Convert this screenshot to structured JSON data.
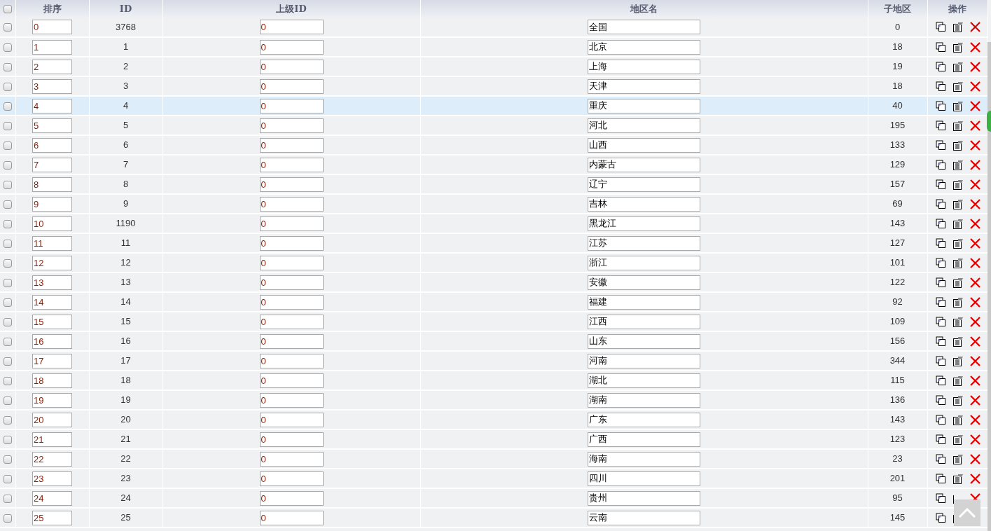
{
  "table": {
    "select_all": {
      "checked": false
    },
    "columns": [
      "排序",
      "ID",
      "上级ID",
      "地区名",
      "子地区",
      "操作"
    ],
    "rows": [
      {
        "checked": false,
        "highlighted": false,
        "sort": "0",
        "id": "3768",
        "parent_id": "0",
        "name": "全国",
        "children_count": "0"
      },
      {
        "checked": false,
        "highlighted": false,
        "sort": "1",
        "id": "1",
        "parent_id": "0",
        "name": "北京",
        "children_count": "18"
      },
      {
        "checked": false,
        "highlighted": false,
        "sort": "2",
        "id": "2",
        "parent_id": "0",
        "name": "上海",
        "children_count": "19"
      },
      {
        "checked": false,
        "highlighted": false,
        "sort": "3",
        "id": "3",
        "parent_id": "0",
        "name": "天津",
        "children_count": "18"
      },
      {
        "checked": false,
        "highlighted": true,
        "sort": "4",
        "id": "4",
        "parent_id": "0",
        "name": "重庆",
        "children_count": "40"
      },
      {
        "checked": false,
        "highlighted": false,
        "sort": "5",
        "id": "5",
        "parent_id": "0",
        "name": "河北",
        "children_count": "195"
      },
      {
        "checked": false,
        "highlighted": false,
        "sort": "6",
        "id": "6",
        "parent_id": "0",
        "name": "山西",
        "children_count": "133"
      },
      {
        "checked": false,
        "highlighted": false,
        "sort": "7",
        "id": "7",
        "parent_id": "0",
        "name": "内蒙古",
        "children_count": "129"
      },
      {
        "checked": false,
        "highlighted": false,
        "sort": "8",
        "id": "8",
        "parent_id": "0",
        "name": "辽宁",
        "children_count": "157"
      },
      {
        "checked": false,
        "highlighted": false,
        "sort": "9",
        "id": "9",
        "parent_id": "0",
        "name": "吉林",
        "children_count": "69"
      },
      {
        "checked": false,
        "highlighted": false,
        "sort": "10",
        "id": "1190",
        "parent_id": "0",
        "name": "黑龙江",
        "children_count": "143"
      },
      {
        "checked": false,
        "highlighted": false,
        "sort": "11",
        "id": "11",
        "parent_id": "0",
        "name": "江苏",
        "children_count": "127"
      },
      {
        "checked": false,
        "highlighted": false,
        "sort": "12",
        "id": "12",
        "parent_id": "0",
        "name": "浙江",
        "children_count": "101"
      },
      {
        "checked": false,
        "highlighted": false,
        "sort": "13",
        "id": "13",
        "parent_id": "0",
        "name": "安徽",
        "children_count": "122"
      },
      {
        "checked": false,
        "highlighted": false,
        "sort": "14",
        "id": "14",
        "parent_id": "0",
        "name": "福建",
        "children_count": "92"
      },
      {
        "checked": false,
        "highlighted": false,
        "sort": "15",
        "id": "15",
        "parent_id": "0",
        "name": "江西",
        "children_count": "109"
      },
      {
        "checked": false,
        "highlighted": false,
        "sort": "16",
        "id": "16",
        "parent_id": "0",
        "name": "山东",
        "children_count": "156"
      },
      {
        "checked": false,
        "highlighted": false,
        "sort": "17",
        "id": "17",
        "parent_id": "0",
        "name": "河南",
        "children_count": "344"
      },
      {
        "checked": false,
        "highlighted": false,
        "sort": "18",
        "id": "18",
        "parent_id": "0",
        "name": "湖北",
        "children_count": "115"
      },
      {
        "checked": false,
        "highlighted": false,
        "sort": "19",
        "id": "19",
        "parent_id": "0",
        "name": "湖南",
        "children_count": "136"
      },
      {
        "checked": false,
        "highlighted": false,
        "sort": "20",
        "id": "20",
        "parent_id": "0",
        "name": "广东",
        "children_count": "143"
      },
      {
        "checked": false,
        "highlighted": false,
        "sort": "21",
        "id": "21",
        "parent_id": "0",
        "name": "广西",
        "children_count": "123"
      },
      {
        "checked": false,
        "highlighted": false,
        "sort": "22",
        "id": "22",
        "parent_id": "0",
        "name": "海南",
        "children_count": "23"
      },
      {
        "checked": false,
        "highlighted": false,
        "sort": "23",
        "id": "23",
        "parent_id": "0",
        "name": "四川",
        "children_count": "201"
      },
      {
        "checked": false,
        "highlighted": false,
        "sort": "24",
        "id": "24",
        "parent_id": "0",
        "name": "贵州",
        "children_count": "95"
      },
      {
        "checked": false,
        "highlighted": false,
        "sort": "25",
        "id": "25",
        "parent_id": "0",
        "name": "云南",
        "children_count": "145"
      }
    ]
  }
}
